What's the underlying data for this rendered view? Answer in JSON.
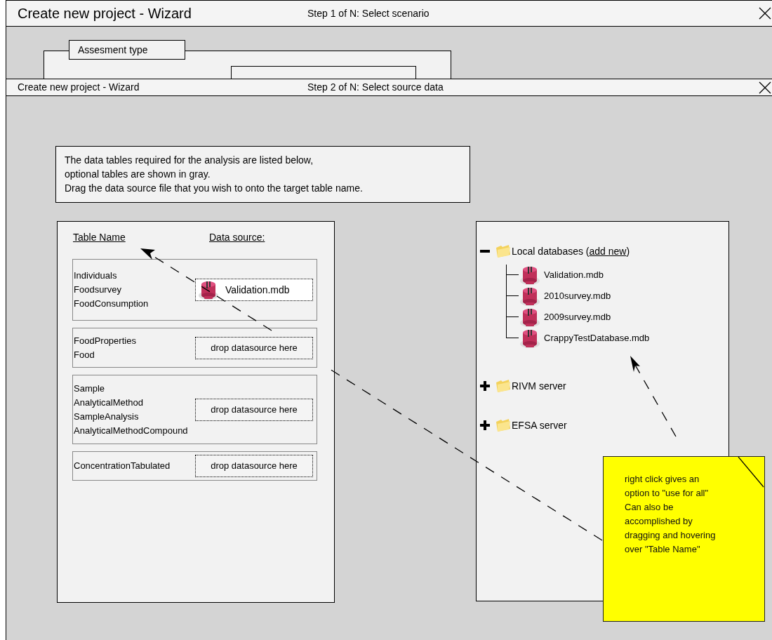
{
  "background_window": {
    "title": "Create new project - Wizard",
    "step": "Step 1 of N: Select scenario",
    "group_label": "Assesment type"
  },
  "window": {
    "title": "Create new project - Wizard",
    "step": "Step 2 of N: Select source data"
  },
  "instructions": [
    "The data tables required for the analysis are listed below,",
    "optional tables are shown in gray.",
    "Drag the data source file that you wish to onto the target table name."
  ],
  "table_panel": {
    "columns": [
      "Table Name",
      "Data source:"
    ],
    "groups": [
      {
        "tables": [
          "Individuals",
          "Foodsurvey",
          "FoodConsumption"
        ],
        "source": {
          "kind": "file",
          "label": "Validation.mdb"
        }
      },
      {
        "tables": [
          "FoodProperties",
          "Food"
        ],
        "source": {
          "kind": "empty",
          "label": "drop datasource here"
        }
      },
      {
        "tables": [
          "Sample",
          "AnalyticalMethod",
          "SampleAnalysis",
          "AnalyticalMethodCompound"
        ],
        "source": {
          "kind": "empty",
          "label": "drop datasource here"
        }
      },
      {
        "tables": [
          "ConcentrationTabulated"
        ],
        "source": {
          "kind": "empty",
          "label": "drop datasource here"
        }
      }
    ]
  },
  "source_tree": [
    {
      "label_before": "Local databases (",
      "link": "add new",
      "label_after": ")",
      "expanded": true,
      "children": [
        {
          "label": "Validation.mdb"
        },
        {
          "label": "2010survey.mdb"
        },
        {
          "label": "2009survey.mdb"
        },
        {
          "label": "CrappyTestDatabase.mdb"
        }
      ]
    },
    {
      "label_before": "RIVM server",
      "expanded": false
    },
    {
      "label_before": "EFSA server",
      "expanded": false
    }
  ],
  "note": {
    "lines": [
      "right click gives an",
      "option to \"use for all\"",
      "Can also be",
      "accomplished by",
      "dragging and hovering",
      "over \"Table Name\""
    ]
  }
}
